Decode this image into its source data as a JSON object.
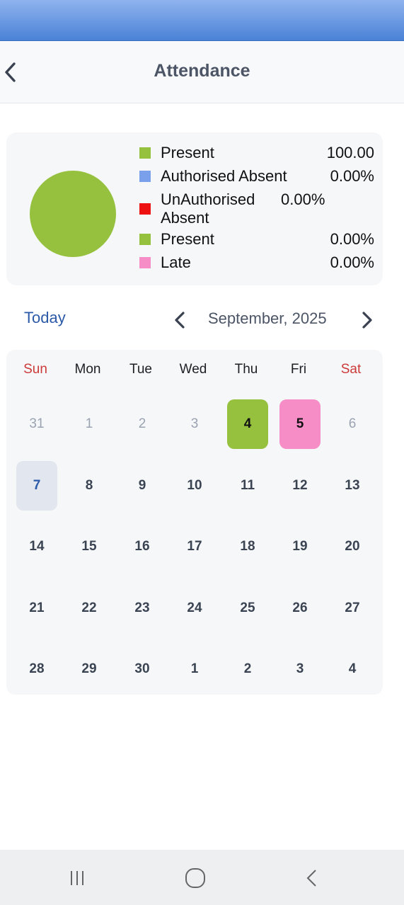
{
  "header": {
    "title": "Attendance"
  },
  "summary": {
    "pie": {
      "type": "pie",
      "values": [
        100,
        0,
        0,
        0,
        0
      ],
      "colors": [
        "#96c13f",
        "#7aa0ec",
        "#ee1111",
        "#96c13f",
        "#f68dc7"
      ]
    },
    "legend": [
      {
        "label": "Present",
        "value": "100.00",
        "color": "#96c13f"
      },
      {
        "label": "Authorised Absent",
        "value": "0.00%",
        "color": "#7aa0ec"
      },
      {
        "label": "UnAuthorised Absent",
        "value": "0.00%",
        "color": "#ee1111"
      },
      {
        "label": "Present",
        "value": "0.00%",
        "color": "#96c13f"
      },
      {
        "label": "Late",
        "value": "0.00%",
        "color": "#f68dc7"
      }
    ]
  },
  "calendar_nav": {
    "today_label": "Today",
    "month_label": "September, 2025",
    "prev_icon": "chevron-left-icon",
    "next_icon": "chevron-right-icon"
  },
  "calendar": {
    "weekdays": [
      "Sun",
      "Mon",
      "Tue",
      "Wed",
      "Thu",
      "Fri",
      "Sat"
    ],
    "weeks": [
      [
        "31",
        "1",
        "2",
        "3",
        "4",
        "5",
        "6"
      ],
      [
        "7",
        "8",
        "9",
        "10",
        "11",
        "12",
        "13"
      ],
      [
        "14",
        "15",
        "16",
        "17",
        "18",
        "19",
        "20"
      ],
      [
        "21",
        "22",
        "23",
        "24",
        "25",
        "26",
        "27"
      ],
      [
        "28",
        "29",
        "30",
        "1",
        "2",
        "3",
        "4"
      ]
    ],
    "outside_days": [
      "0-0",
      "0-1",
      "0-2",
      "0-3",
      "0-6"
    ],
    "today_cell": "1-0",
    "status_cells": {
      "0-4": "present",
      "0-5": "late"
    },
    "colors": {
      "present": "#96c13f",
      "late": "#f68dc7",
      "today_text": "#2c5aa8",
      "weekend": "#cd3a3a"
    }
  },
  "system_nav": {
    "icons": [
      "recent-apps-icon",
      "home-icon",
      "back-icon"
    ]
  }
}
